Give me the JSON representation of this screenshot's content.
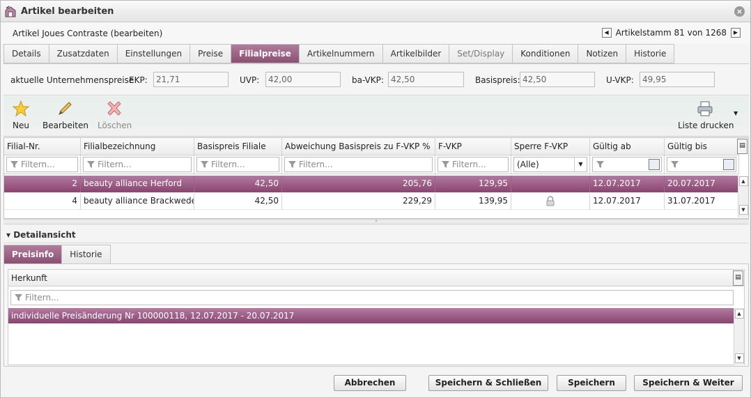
{
  "window": {
    "title": "Artikel bearbeiten",
    "subtitle": "Artikel Joues Contraste (bearbeiten)",
    "nav_text": "Artikelstamm 81 von 1268"
  },
  "tabs": [
    "Details",
    "Zusatzdaten",
    "Einstellungen",
    "Preise",
    "Filialpreise",
    "Artikelnummern",
    "Artikelbilder",
    "Set/Display",
    "Konditionen",
    "Notizen",
    "Historie"
  ],
  "active_tab": "Filialpreise",
  "prices": {
    "label": "aktuelle Unternehmenspreise",
    "ekp_label": "EKP:",
    "ekp": "21,71",
    "uvp_label": "UVP:",
    "uvp": "42,00",
    "bavkp_label": "ba-VKP:",
    "bavkp": "42,50",
    "basis_label": "Basispreis:",
    "basis": "42,50",
    "uvkp_label": "U-VKP:",
    "uvkp": "49,95"
  },
  "toolbar": {
    "new": "Neu",
    "edit": "Bearbeiten",
    "delete": "Löschen",
    "print": "Liste drucken"
  },
  "grid": {
    "columns": [
      "Filial-Nr.",
      "Filialbezeichnung",
      "Basispreis Filiale",
      "Abweichung Basispreis zu F-VKP %",
      "F-VKP",
      "Sperre F-VKP",
      "Gültig ab",
      "Gültig bis"
    ],
    "filter_placeholder": "Filtern...",
    "sperre_option": "(Alle)",
    "rows": [
      {
        "nr": "2",
        "name": "beauty alliance Herford",
        "basis": "42,50",
        "abw": "205,76",
        "fvkp": "129,95",
        "sperre": "",
        "ab": "12.07.2017",
        "bis": "20.07.2017"
      },
      {
        "nr": "4",
        "name": "beauty alliance Brackwede",
        "basis": "42,50",
        "abw": "229,29",
        "fvkp": "139,95",
        "sperre": "lock",
        "ab": "12.07.2017",
        "bis": "31.07.2017"
      }
    ]
  },
  "detail": {
    "title": "Detailansicht",
    "tabs": [
      "Preisinfo",
      "Historie"
    ],
    "active_tab": "Preisinfo",
    "column": "Herkunft",
    "filter_placeholder": "Filtern...",
    "rows": [
      "individuelle Preisänderung Nr 100000118, 12.07.2017 - 20.07.2017"
    ]
  },
  "footer": {
    "cancel": "Abbrechen",
    "save_close": "Speichern & Schließen",
    "save": "Speichern",
    "save_next": "Speichern & Weiter"
  }
}
